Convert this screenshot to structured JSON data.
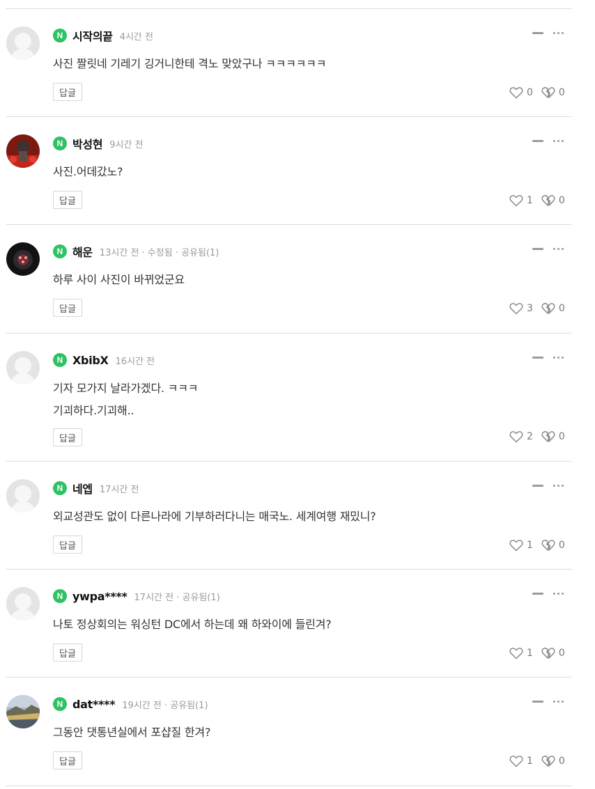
{
  "comments": [
    {
      "author": "시작의끝",
      "meta": "4시간 전",
      "text": "사진 짤릿네 기레기 깅거니한테 격노 맞았구나 ㅋㅋㅋㅋㅋㅋ",
      "reply": "답글",
      "likes": "0",
      "dislikes": "0",
      "avatar": "default"
    },
    {
      "author": "박성현",
      "meta": "9시간 전",
      "text": "사진.어데갔노?",
      "reply": "답글",
      "likes": "1",
      "dislikes": "0",
      "avatar": "photo-red"
    },
    {
      "author": "해운",
      "meta": "13시간 전 · 수정됨 · 공유됨(1)",
      "text": "하루 사이 사진이 바뀌었군요",
      "reply": "답글",
      "likes": "3",
      "dislikes": "0",
      "avatar": "photo-dark"
    },
    {
      "author": "XbibX",
      "meta": "16시간 전",
      "text": "기자 모가지 날라가겠다. ㅋㅋㅋ\n기괴하다.기괴해..",
      "reply": "답글",
      "likes": "2",
      "dislikes": "0",
      "avatar": "default"
    },
    {
      "author": "네엡",
      "meta": "17시간 전",
      "text": "외교성관도 없이 다른나라에 기부하러다니는 매국노. 세계여행 재밌니?",
      "reply": "답글",
      "likes": "1",
      "dislikes": "0",
      "avatar": "default"
    },
    {
      "author": "ywpa****",
      "meta": "17시간 전 · 공유됨(1)",
      "text": "나토 정상회의는 워싱턴 DC에서 하는데 왜 하와이에 들린겨?",
      "reply": "답글",
      "likes": "1",
      "dislikes": "0",
      "avatar": "default"
    },
    {
      "author": "dat****",
      "meta": "19시간 전 · 공유됨(1)",
      "text": "그동안 댓통년실에서 포샵질 한겨?",
      "reply": "답글",
      "likes": "1",
      "dislikes": "0",
      "avatar": "photo-landscape"
    }
  ],
  "badge_letter": "N",
  "colors": {
    "badge": "#2ec262",
    "divider": "#dcdcdc",
    "meta": "#9a9a9a"
  }
}
